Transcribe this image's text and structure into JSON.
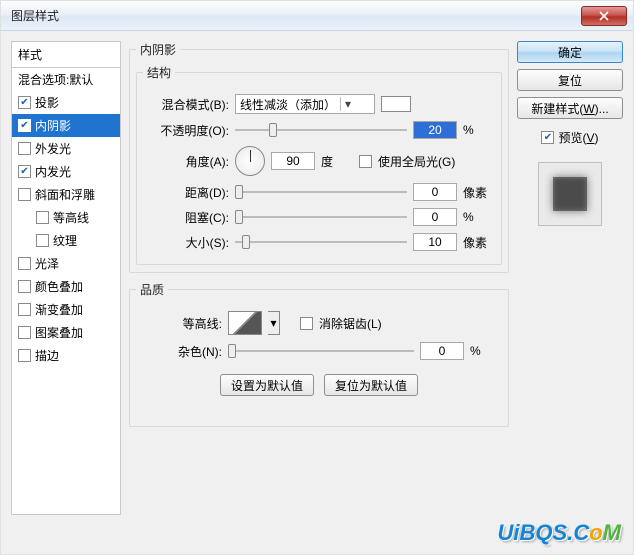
{
  "window": {
    "title": "图层样式"
  },
  "buttons": {
    "ok": "确定",
    "reset": "复位",
    "new_style": "新建样式(W)...",
    "preview": "预览(V)",
    "set_default": "设置为默认值",
    "reset_default": "复位为默认值"
  },
  "styles": {
    "header": "样式",
    "blend_options": "混合选项:默认",
    "items": [
      {
        "label": "投影",
        "checked": true,
        "selected": false
      },
      {
        "label": "内阴影",
        "checked": true,
        "selected": true
      },
      {
        "label": "外发光",
        "checked": false,
        "selected": false
      },
      {
        "label": "内发光",
        "checked": true,
        "selected": false
      },
      {
        "label": "斜面和浮雕",
        "checked": false,
        "selected": false
      },
      {
        "label": "等高线",
        "checked": false,
        "selected": false,
        "indent": true
      },
      {
        "label": "纹理",
        "checked": false,
        "selected": false,
        "indent": true
      },
      {
        "label": "光泽",
        "checked": false,
        "selected": false
      },
      {
        "label": "颜色叠加",
        "checked": false,
        "selected": false
      },
      {
        "label": "渐变叠加",
        "checked": false,
        "selected": false
      },
      {
        "label": "图案叠加",
        "checked": false,
        "selected": false
      },
      {
        "label": "描边",
        "checked": false,
        "selected": false
      }
    ]
  },
  "panel": {
    "title": "内阴影",
    "structure": {
      "legend": "结构",
      "blend_mode_label": "混合模式(B):",
      "blend_mode_value": "线性减淡（添加）",
      "opacity_label": "不透明度(O):",
      "opacity_value": "20",
      "opacity_unit": "%",
      "angle_label": "角度(A):",
      "angle_value": "90",
      "angle_unit": "度",
      "use_global_label": "使用全局光(G)",
      "use_global_checked": false,
      "distance_label": "距离(D):",
      "distance_value": "0",
      "distance_unit": "像素",
      "choke_label": "阻塞(C):",
      "choke_value": "0",
      "choke_unit": "%",
      "size_label": "大小(S):",
      "size_value": "10",
      "size_unit": "像素"
    },
    "quality": {
      "legend": "品质",
      "contour_label": "等高线:",
      "antialias_label": "消除锯齿(L)",
      "antialias_checked": false,
      "noise_label": "杂色(N):",
      "noise_value": "0",
      "noise_unit": "%"
    }
  },
  "watermark": {
    "text": "UiBQS.CoM"
  }
}
